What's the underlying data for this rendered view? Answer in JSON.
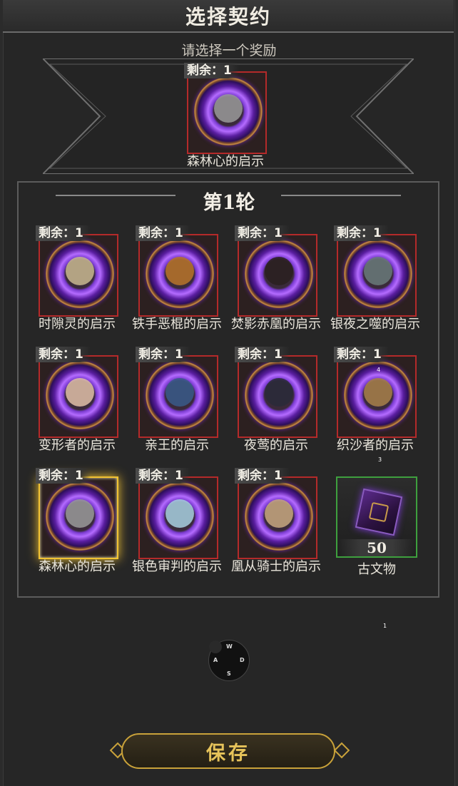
{
  "title": "选择契约",
  "reward_prompt": "请选择一个奖励",
  "featured": {
    "remaining": "剩余：1",
    "name": "森林心的启示"
  },
  "round_title": "第1轮",
  "cards": [
    {
      "remaining": "剩余：1",
      "name": "时隙灵的启示",
      "color": "#c9b890"
    },
    {
      "remaining": "剩余：1",
      "name": "铁手恶棍的启示",
      "color": "#b8742a"
    },
    {
      "remaining": "剩余：1",
      "name": "焚影赤凰的启示",
      "color": "#2a2020"
    },
    {
      "remaining": "剩余：1",
      "name": "银夜之噬的启示",
      "color": "#6a7a7a"
    },
    {
      "remaining": "剩余：1",
      "name": "变形者的启示",
      "color": "#e0c0a8"
    },
    {
      "remaining": "剩余：1",
      "name": "亲王的启示",
      "color": "#3a5a8a"
    },
    {
      "remaining": "剩余：1",
      "name": "夜莺的启示",
      "color": "#2a2a3a"
    },
    {
      "remaining": "剩余：1",
      "name": "织沙者的启示",
      "color": "#a8804a"
    },
    {
      "remaining": "剩余：1",
      "name": "森林心的启示",
      "color": "#9a9a9a",
      "selected": true
    },
    {
      "remaining": "剩余：1",
      "name": "银色审判的启示",
      "color": "#a8d0e0"
    },
    {
      "remaining": "剩余：1",
      "name": "凰从骑士的启示",
      "color": "#c8a880"
    }
  ],
  "artifact": {
    "count": "50",
    "name": "古文物"
  },
  "dpad": {
    "up": "W",
    "left": "A",
    "right": "D",
    "down": "S"
  },
  "save_label": "保存",
  "overlay_digits": [
    "4",
    "3",
    "1"
  ]
}
